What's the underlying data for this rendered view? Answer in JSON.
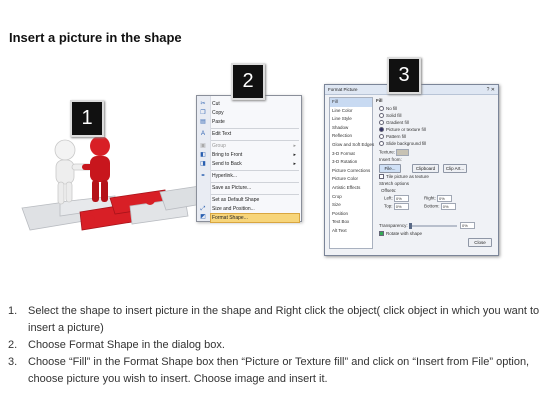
{
  "title": "Insert a picture in the shape",
  "badges": [
    "1",
    "2",
    "3"
  ],
  "context_menu": {
    "items": [
      {
        "label": "Cut",
        "icon": "scissors-icon",
        "enabled": true
      },
      {
        "label": "Copy",
        "icon": "copy-icon",
        "enabled": true
      },
      {
        "label": "Paste",
        "icon": "paste-icon",
        "enabled": true
      },
      {
        "label": "Edit Text",
        "icon": "edit-text-icon",
        "enabled": true
      },
      {
        "label": "Group",
        "icon": "group-icon",
        "enabled": false,
        "submenu": true
      },
      {
        "label": "Bring to Front",
        "icon": "bring-front-icon",
        "enabled": true,
        "submenu": true
      },
      {
        "label": "Send to Back",
        "icon": "send-back-icon",
        "enabled": true,
        "submenu": true
      },
      {
        "label": "Hyperlink...",
        "icon": "hyperlink-icon",
        "enabled": true
      },
      {
        "label": "Save as Picture...",
        "icon": "",
        "enabled": true
      },
      {
        "label": "Set as Default Shape",
        "icon": "",
        "enabled": true
      },
      {
        "label": "Size and Position...",
        "icon": "size-position-icon",
        "enabled": true
      },
      {
        "label": "Format Shape...",
        "icon": "format-shape-icon",
        "enabled": true,
        "selected": true
      }
    ]
  },
  "dialog": {
    "title": "Format Picture",
    "categories": [
      "Fill",
      "Line Color",
      "Line Style",
      "Shadow",
      "Reflection",
      "Glow and Soft Edges",
      "3-D Format",
      "3-D Rotation",
      "Picture Corrections",
      "Picture Color",
      "Artistic Effects",
      "Crop",
      "Size",
      "Position",
      "Text Box",
      "Alt Text"
    ],
    "selected_category": "Fill",
    "section_title": "Fill",
    "fill_options": [
      "No fill",
      "Solid fill",
      "Gradient fill",
      "Picture or texture fill",
      "Pattern fill",
      "Slide background fill"
    ],
    "selected_fill": "Picture or texture fill",
    "texture_label": "Texture:",
    "insert_from_label": "Insert from:",
    "buttons": {
      "file": "File...",
      "clipboard": "Clipboard",
      "clip_art": "Clip Art...",
      "close": "Close"
    },
    "tile_label": "Tile picture as texture",
    "stretch_label": "Stretch options",
    "offsets_label": "Offsets:",
    "offsets": [
      {
        "label": "Left:",
        "value": "0%"
      },
      {
        "label": "Right:",
        "value": "0%"
      },
      {
        "label": "Top:",
        "value": "0%"
      },
      {
        "label": "Bottom:",
        "value": "0%"
      }
    ],
    "transparency_label": "Transparency:",
    "transparency_value": "0%",
    "rotate_label": "Rotate with shape"
  },
  "steps": [
    {
      "num": "1.",
      "text": "Select the shape to insert picture in the shape and Right click the object( click object in which you want to insert a picture)"
    },
    {
      "num": "2.",
      "text": "Choose Format Shape in the dialog box."
    },
    {
      "num": "3.",
      "text": "Choose “Fill” in the Format Shape box then “Picture or Texture fill”  and click on “Insert from File” option, choose picture you wish to insert. Choose image and insert it."
    }
  ],
  "colors": {
    "puzzle_red": "#d81f26",
    "puzzle_gray": "#dfe1e4",
    "menu_highlight": "#f7d57a"
  }
}
